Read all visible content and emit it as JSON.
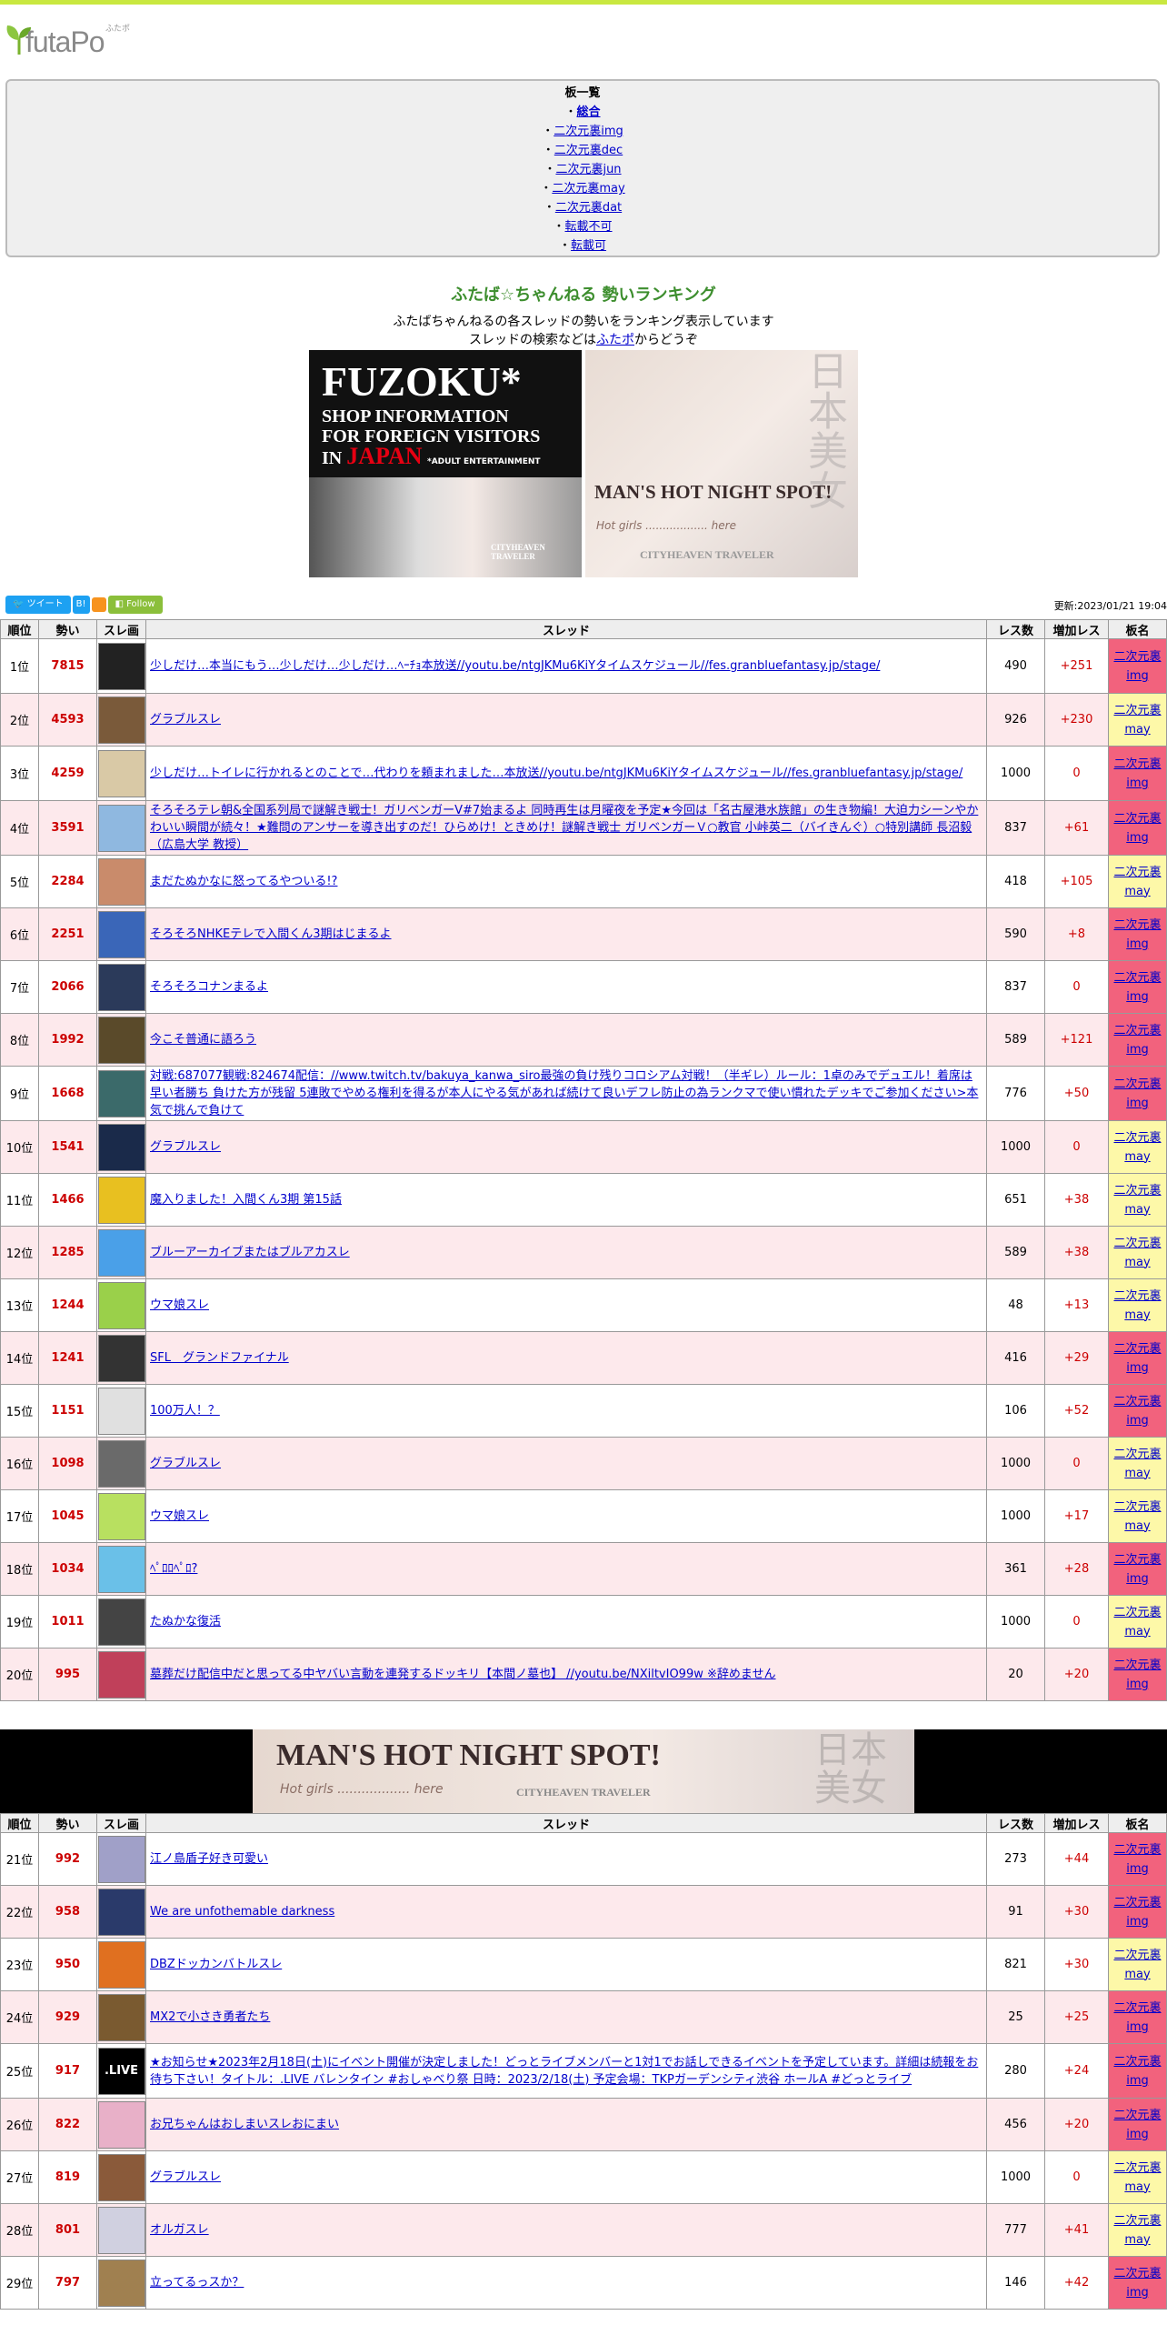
{
  "site": {
    "logo_text": "futaPo",
    "logo_ruby": "ふたポ"
  },
  "boards": {
    "title": "板一覧",
    "items": [
      "総合",
      "二次元裏img",
      "二次元裏dec",
      "二次元裏jun",
      "二次元裏may",
      "二次元裏dat",
      "転載不可",
      "転載可"
    ]
  },
  "header": {
    "title": "ふたば☆ちゃんねる 勢いランキング",
    "desc1": "ふたばちゃんねるの各スレッドの勢いをランキング表示しています",
    "desc2_pre": "スレッドの検索などは",
    "desc2_link": "ふたポ",
    "desc2_post": "からどうぞ"
  },
  "ads": {
    "fuzoku_title": "FUZOKU*",
    "fuzoku_sub1": "SHOP INFORMATION",
    "fuzoku_sub2": "FOR FOREIGN VISITORS",
    "fuzoku_sub3_pre": "IN ",
    "fuzoku_sub3_red": "JAPAN",
    "fuzoku_note": "*ADULT ENTERTAINMENT",
    "man_title": "MAN'S HOT NIGHT SPOT!",
    "man_sub": "Hot girls .................. here",
    "brand": "CITYHEAVEN TRAVELER",
    "kanji": "日本美女"
  },
  "social": {
    "tweet": "ツイート",
    "hatena": "B!",
    "follow": "Follow"
  },
  "updated": "更新:2023/01/21 19:04",
  "columns": [
    "順位",
    "勢い",
    "スレ画",
    "スレッド",
    "レス数",
    "増加レス",
    "板名"
  ],
  "colors": {
    "top_bar": "#c9e840",
    "speed": "#cc0000",
    "board_img": "#f2627d",
    "board_may": "#fdf8a8",
    "row_even": "#fde9ec"
  },
  "rows1": [
    {
      "rank": "1位",
      "speed": "7815",
      "thumb": "#222222",
      "title": "少しだけ…本当にもう…少しだけ…少しだけ…ﾍｰﾁｮ本放送//youtu.be/ntgJKMu6KiYタイムスケジュール//fes.granbluefantasy.jp/stage/",
      "res": "490",
      "inc": "+251",
      "board": "二次元裏 img",
      "bt": "img"
    },
    {
      "rank": "2位",
      "speed": "4593",
      "thumb": "#7a5a3a",
      "title": "グラブルスレ",
      "res": "926",
      "inc": "+230",
      "board": "二次元裏 may",
      "bt": "may"
    },
    {
      "rank": "3位",
      "speed": "4259",
      "thumb": "#d9c9a6",
      "title": "少しだけ…トイレに行かれるとのことで…代わりを頼まれました…本放送//youtu.be/ntgJKMu6KiYタイムスケジュール//fes.granbluefantasy.jp/stage/",
      "res": "1000",
      "inc": "0",
      "board": "二次元裏 img",
      "bt": "img"
    },
    {
      "rank": "4位",
      "speed": "3591",
      "thumb": "#8fb8e0",
      "title": "そろそろテレ朝&全国系列局で謎解き戦士！ガリベンガーV#7始まるよ 同時再生は月曜夜を予定★今回は「名古屋港水族館」の生き物編！大迫力シーンやかわいい瞬間が続々！★難問のアンサーを導き出すのだ！ひらめけ！ときめけ！謎解き戦士 ガリベンガーＶ○教官 小峠英二（バイきんぐ）○特別講師 長沼毅（広島大学 教授）",
      "res": "837",
      "inc": "+61",
      "board": "二次元裏 img",
      "bt": "img"
    },
    {
      "rank": "5位",
      "speed": "2284",
      "thumb": "#c98b6b",
      "title": "まだたぬかなに怒ってるやついる!?",
      "res": "418",
      "inc": "+105",
      "board": "二次元裏 may",
      "bt": "may"
    },
    {
      "rank": "6位",
      "speed": "2251",
      "thumb": "#3a66b8",
      "title": "そろそろNHKEテレで入間くん3期はじまるよ",
      "res": "590",
      "inc": "+8",
      "board": "二次元裏 img",
      "bt": "img"
    },
    {
      "rank": "7位",
      "speed": "2066",
      "thumb": "#2b3a5a",
      "title": "そろそろコナンまるよ",
      "res": "837",
      "inc": "0",
      "board": "二次元裏 img",
      "bt": "img"
    },
    {
      "rank": "8位",
      "speed": "1992",
      "thumb": "#5a4a2a",
      "title": "今こそ普通に語ろう",
      "res": "589",
      "inc": "+121",
      "board": "二次元裏 img",
      "bt": "img"
    },
    {
      "rank": "9位",
      "speed": "1668",
      "thumb": "#3b6a6a",
      "title": "対戦:687077観戦:824674配信：//www.twitch.tv/bakuya_kanwa_siro最強の負け残りコロシアム対戦！（半ギレ）ルール：1卓のみでデュエル！着席は早い者勝ち 負けた方が残留 5連敗でやめる権利を得るが本人にやる気があれば続けて良いデフレ防止の為ランクマで使い慣れたデッキでご参加ください>本気で挑んで負けて",
      "res": "776",
      "inc": "+50",
      "board": "二次元裏 img",
      "bt": "img"
    },
    {
      "rank": "10位",
      "speed": "1541",
      "thumb": "#1a2a4a",
      "title": "グラブルスレ",
      "res": "1000",
      "inc": "0",
      "board": "二次元裏 may",
      "bt": "may"
    },
    {
      "rank": "11位",
      "speed": "1466",
      "thumb": "#e8c020",
      "title": "魔入りました！入間くん3期 第15話",
      "res": "651",
      "inc": "+38",
      "board": "二次元裏 may",
      "bt": "may"
    },
    {
      "rank": "12位",
      "speed": "1285",
      "thumb": "#4aa0e8",
      "title": "ブルーアーカイブまたはブルアカスレ",
      "res": "589",
      "inc": "+38",
      "board": "二次元裏 may",
      "bt": "may"
    },
    {
      "rank": "13位",
      "speed": "1244",
      "thumb": "#9ad04a",
      "title": "ウマ娘スレ",
      "res": "48",
      "inc": "+13",
      "board": "二次元裏 may",
      "bt": "may"
    },
    {
      "rank": "14位",
      "speed": "1241",
      "thumb": "#333333",
      "title": "SFL　グランドファイナル",
      "res": "416",
      "inc": "+29",
      "board": "二次元裏 img",
      "bt": "img"
    },
    {
      "rank": "15位",
      "speed": "1151",
      "thumb": "#e0e0e0",
      "title": "100万人！？",
      "res": "106",
      "inc": "+52",
      "board": "二次元裏 img",
      "bt": "img"
    },
    {
      "rank": "16位",
      "speed": "1098",
      "thumb": "#6a6a6a",
      "title": "グラブルスレ",
      "res": "1000",
      "inc": "0",
      "board": "二次元裏 may",
      "bt": "may"
    },
    {
      "rank": "17位",
      "speed": "1045",
      "thumb": "#b8e060",
      "title": "ウマ娘スレ",
      "res": "1000",
      "inc": "+17",
      "board": "二次元裏 may",
      "bt": "may"
    },
    {
      "rank": "18位",
      "speed": "1034",
      "thumb": "#6ac0e8",
      "title": "ﾍﾟﾛﾛﾍﾟﾛ?",
      "res": "361",
      "inc": "+28",
      "board": "二次元裏 img",
      "bt": "img"
    },
    {
      "rank": "19位",
      "speed": "1011",
      "thumb": "#444444",
      "title": "たぬかな復活",
      "res": "1000",
      "inc": "0",
      "board": "二次元裏 may",
      "bt": "may"
    },
    {
      "rank": "20位",
      "speed": "995",
      "thumb": "#c0405a",
      "title": "墓葬だけ配信中だと思ってる中ヤバい言動を連発するドッキリ【本間ノ墓也】 //youtu.be/NXiltvIO99w ※辞めません",
      "res": "20",
      "inc": "+20",
      "board": "二次元裏 img",
      "bt": "img"
    }
  ],
  "rows2": [
    {
      "rank": "21位",
      "speed": "992",
      "thumb": "#a0a0c8",
      "title": "江ノ島盾子好き可愛い",
      "res": "273",
      "inc": "+44",
      "board": "二次元裏 img",
      "bt": "img"
    },
    {
      "rank": "22位",
      "speed": "958",
      "thumb": "#2a3a6a",
      "title": "We are unfothemable darkness",
      "res": "91",
      "inc": "+30",
      "board": "二次元裏 img",
      "bt": "img"
    },
    {
      "rank": "23位",
      "speed": "950",
      "thumb": "#e07020",
      "title": "DBZドッカンバトルスレ",
      "res": "821",
      "inc": "+30",
      "board": "二次元裏 may",
      "bt": "may"
    },
    {
      "rank": "24位",
      "speed": "929",
      "thumb": "#7a5a30",
      "title": "MX2で小さき勇者たち",
      "res": "25",
      "inc": "+25",
      "board": "二次元裏 img",
      "bt": "img"
    },
    {
      "rank": "25位",
      "speed": "917",
      "thumb": "#000000",
      "thumb_text": ".LIVE",
      "title": "★お知らせ★2023年2月18日(土)にイベント開催が決定しました！どっとライブメンバーと1対1でお話しできるイベントを予定しています。詳細は続報をお待ち下さい！タイトル：.LIVE バレンタイン #おしゃべり祭 日時：2023/2/18(土) 予定会場：TKPガーデンシティ渋谷 ホールA #どっとライブ",
      "res": "280",
      "inc": "+24",
      "board": "二次元裏 img",
      "bt": "img"
    },
    {
      "rank": "26位",
      "speed": "822",
      "thumb": "#e8b0c8",
      "title": "お兄ちゃんはおしまいスレおにまい",
      "res": "456",
      "inc": "+20",
      "board": "二次元裏 img",
      "bt": "img"
    },
    {
      "rank": "27位",
      "speed": "819",
      "thumb": "#8a5a3a",
      "title": "グラブルスレ",
      "res": "1000",
      "inc": "0",
      "board": "二次元裏 may",
      "bt": "may"
    },
    {
      "rank": "28位",
      "speed": "801",
      "thumb": "#d0d0e0",
      "title": "オルガスレ",
      "res": "777",
      "inc": "+41",
      "board": "二次元裏 may",
      "bt": "may"
    },
    {
      "rank": "29位",
      "speed": "797",
      "thumb": "#a08050",
      "title": "立ってるっスか？",
      "res": "146",
      "inc": "+42",
      "board": "二次元裏 img",
      "bt": "img"
    }
  ]
}
